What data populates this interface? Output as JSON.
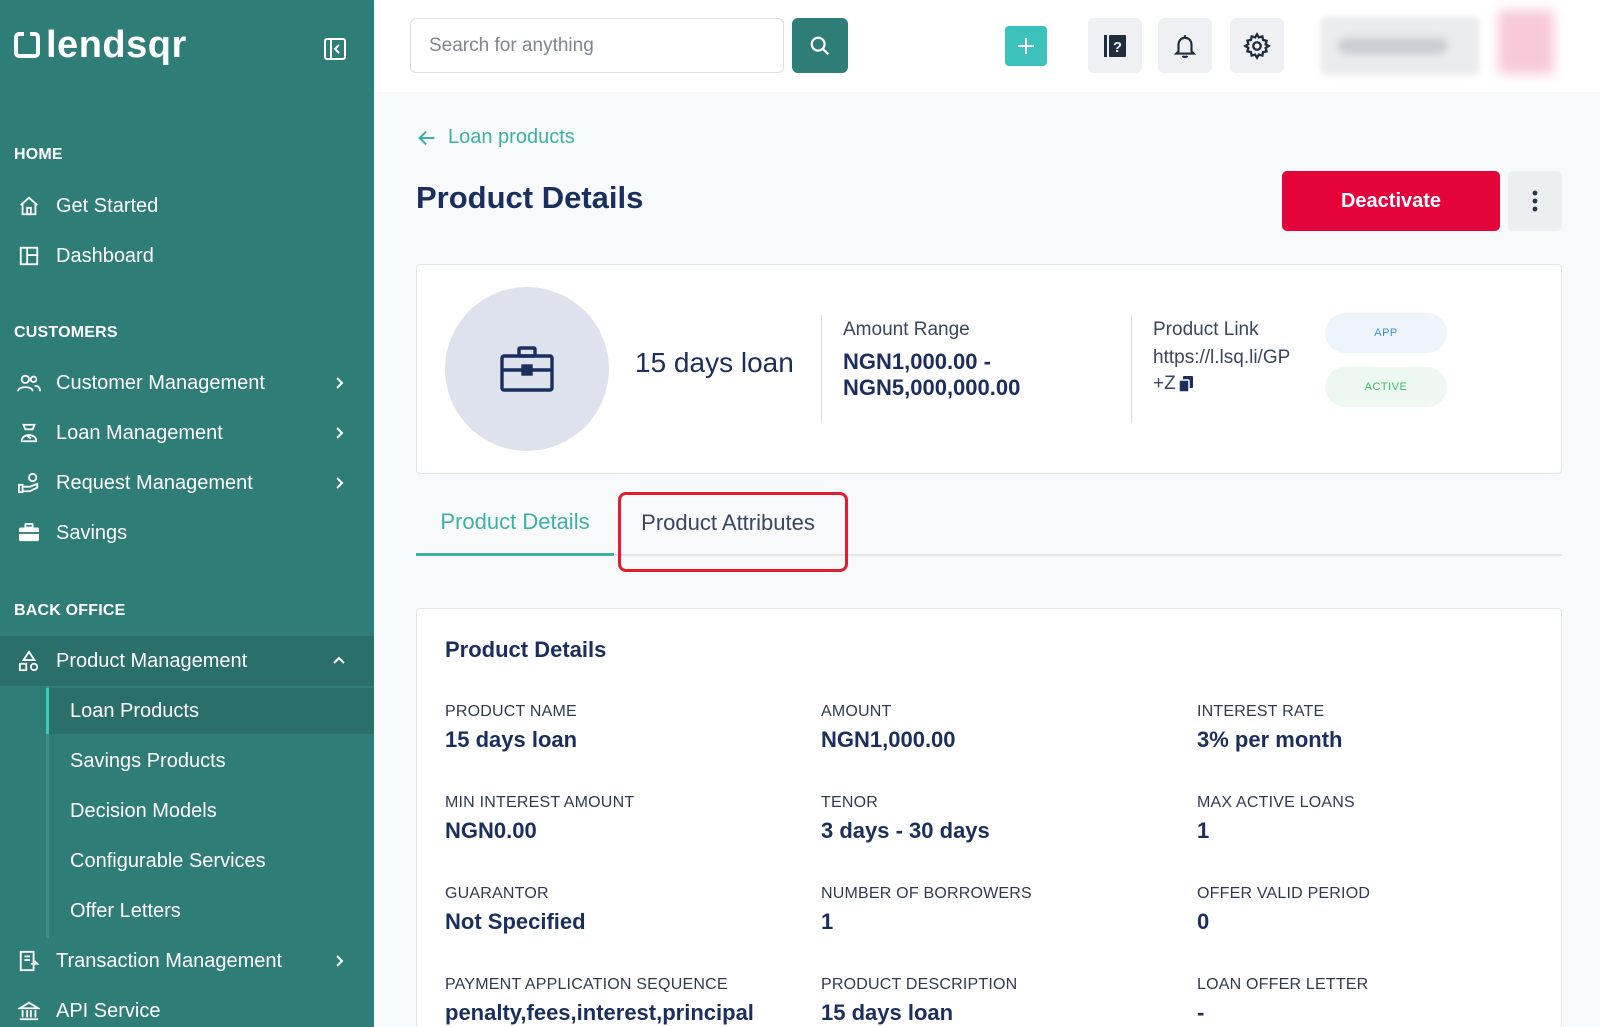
{
  "brand": {
    "name": "lendsqr"
  },
  "sidebar": {
    "sections": {
      "home": "HOME",
      "customers": "CUSTOMERS",
      "back_office": "BACK OFFICE"
    },
    "home_items": [
      {
        "label": "Get Started",
        "icon": "home-icon"
      },
      {
        "label": "Dashboard",
        "icon": "dashboard-icon"
      }
    ],
    "customer_items": [
      {
        "label": "Customer Management",
        "icon": "users-icon"
      },
      {
        "label": "Loan Management",
        "icon": "loan-icon"
      },
      {
        "label": "Request Management",
        "icon": "request-icon"
      },
      {
        "label": "Savings",
        "icon": "briefcase-icon"
      }
    ],
    "product_management": {
      "label": "Product Management",
      "icon": "shapes-icon"
    },
    "product_sub_items": [
      {
        "label": "Loan Products"
      },
      {
        "label": "Savings Products"
      },
      {
        "label": "Decision Models"
      },
      {
        "label": "Configurable Services"
      },
      {
        "label": "Offer Letters"
      }
    ],
    "more_items": [
      {
        "label": "Transaction Management",
        "icon": "transaction-icon"
      },
      {
        "label": "API Service",
        "icon": "bank-icon"
      }
    ]
  },
  "topbar": {
    "search_placeholder": "Search for anything"
  },
  "page": {
    "back_label": "Loan products",
    "title": "Product Details",
    "deactivate_label": "Deactivate"
  },
  "summary": {
    "product_name": "15 days loan",
    "amount_range_label": "Amount Range",
    "amount_range_line1": "NGN1,000.00 -",
    "amount_range_line2": "NGN5,000,000.00",
    "product_link_label": "Product Link",
    "product_link_value": "https://l.lsq.li/GP+Z",
    "badge_app": "APP",
    "badge_active": "ACTIVE"
  },
  "tabs": {
    "details": "Product Details",
    "attributes": "Product Attributes"
  },
  "details": {
    "title": "Product Details",
    "fields": [
      {
        "label": "PRODUCT NAME",
        "value": "15 days loan"
      },
      {
        "label": "AMOUNT",
        "value": "NGN1,000.00"
      },
      {
        "label": "INTEREST RATE",
        "value": "3% per month"
      },
      {
        "label": "MIN INTEREST AMOUNT",
        "value": "NGN0.00"
      },
      {
        "label": "TENOR",
        "value": "3 days - 30 days"
      },
      {
        "label": "MAX ACTIVE LOANS",
        "value": "1"
      },
      {
        "label": "GUARANTOR",
        "value": "Not Specified"
      },
      {
        "label": "NUMBER OF BORROWERS",
        "value": "1"
      },
      {
        "label": "OFFER VALID PERIOD",
        "value": "0"
      },
      {
        "label": "PAYMENT APPLICATION SEQUENCE",
        "value": "penalty,fees,interest,principal"
      },
      {
        "label": "PRODUCT DESCRIPTION",
        "value": "15 days loan"
      },
      {
        "label": "LOAN OFFER LETTER",
        "value": "-"
      }
    ]
  },
  "colors": {
    "sidebar_bg": "#2e7d76",
    "accent_teal": "#3cb0a7",
    "danger": "#e4033b",
    "title_navy": "#1a2f5e"
  }
}
